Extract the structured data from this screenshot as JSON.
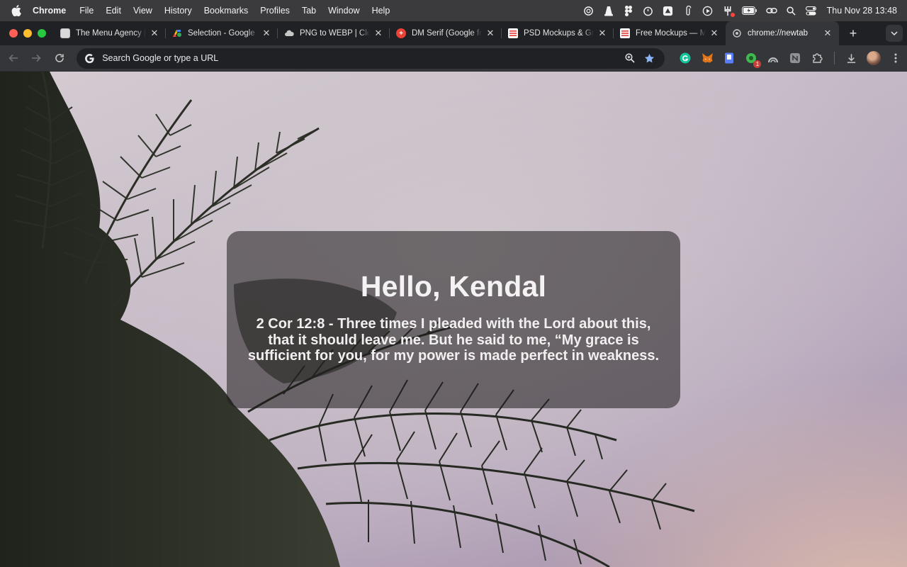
{
  "menubar": {
    "app_name": "Chrome",
    "items": [
      "File",
      "Edit",
      "View",
      "History",
      "Bookmarks",
      "Profiles",
      "Tab",
      "Window",
      "Help"
    ],
    "status_icons": [
      "openai-icon",
      "vlc-icon",
      "figma-icon",
      "timer-icon",
      "drive-icon",
      "paperclip-icon",
      "play-icon",
      "fork-icon",
      "battery-icon",
      "link-icon",
      "search-icon",
      "control-center-icon"
    ],
    "clock": "Thu Nov 28  13:48"
  },
  "tabs": [
    {
      "title": "The Menu Agency |",
      "favicon_color": "#d9d9d9",
      "active": false
    },
    {
      "title": "Selection - Google F",
      "favicon_color": "#4285f4",
      "active": false
    },
    {
      "title": "PNG to WEBP | Cloud",
      "favicon_color": "#9aa0a6",
      "active": false
    },
    {
      "title": "DM Serif (Google fon",
      "favicon_color": "#ea4335",
      "active": false
    },
    {
      "title": "PSD Mockups & Gra",
      "favicon_color": "#e53935",
      "active": false
    },
    {
      "title": "Free Mockups — Mr",
      "favicon_color": "#e53935",
      "active": false
    },
    {
      "title": "chrome://newtab",
      "favicon_color": "#9aa0a6",
      "active": true
    }
  ],
  "toolbar": {
    "omnibox_placeholder": "Search Google or type a URL",
    "extension_badge": "1"
  },
  "card": {
    "greeting": "Hello, Kendal",
    "verse": "2 Cor 12:8 - Three times I pleaded with the Lord about this, that it should leave me. But he said to me, “My grace is sufficient for you, for my power is made perfect in weakness."
  },
  "colors": {
    "menubar_bg": "#3b3a3d",
    "tabstrip_bg": "#202124",
    "toolbar_bg": "#35363a",
    "star_blue": "#8ab4f8",
    "card_bg": "rgba(30,28,28,0.55)"
  }
}
